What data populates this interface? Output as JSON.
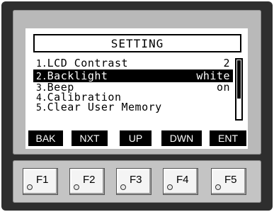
{
  "screen": {
    "title": "SETTING",
    "menu": [
      {
        "num": "1.",
        "label": "LCD Contrast",
        "value": "2"
      },
      {
        "num": "2.",
        "label": "Backlight",
        "value": "white"
      },
      {
        "num": "3.",
        "label": "Beep",
        "value": "on"
      },
      {
        "num": "4.",
        "label": "Calibration",
        "value": ""
      },
      {
        "num": "5.",
        "label": "Clear User Memory",
        "value": ""
      }
    ],
    "selected_index": 1,
    "softkeys": [
      "BAK",
      "NXT",
      "UP",
      "DWN",
      "ENT"
    ]
  },
  "function_keys": [
    "F1",
    "F2",
    "F3",
    "F4",
    "F5"
  ],
  "colors": {
    "housing": "#2e2e2e",
    "bezel": "#b9b9b9",
    "lcd_background": "#ffffff",
    "lcd_ink": "#000000",
    "key_panel": "#c4c4c4"
  }
}
